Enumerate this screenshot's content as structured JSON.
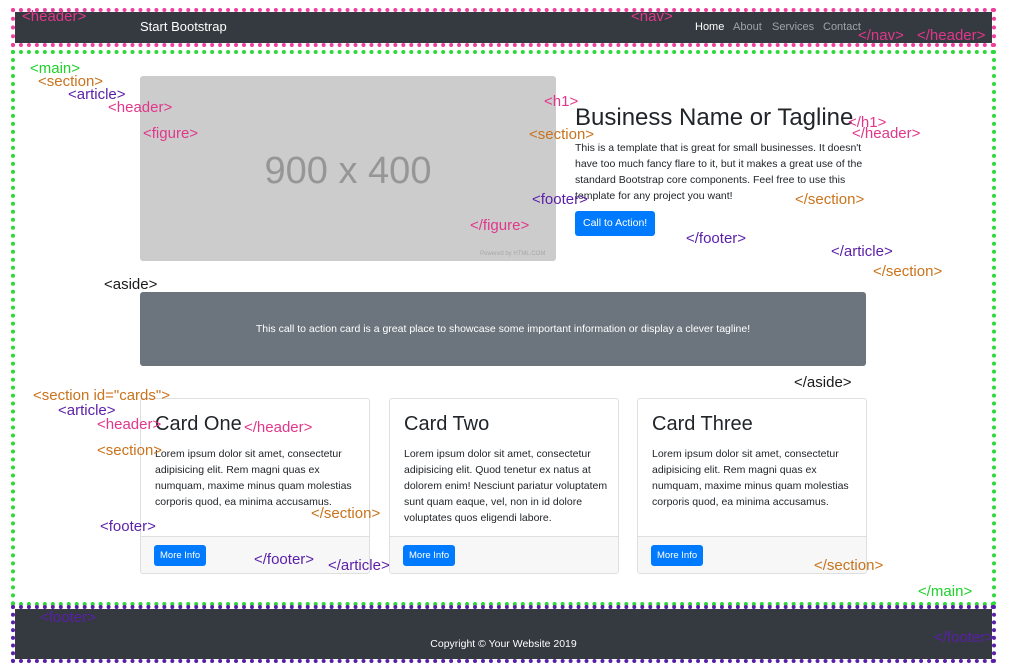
{
  "navbar": {
    "brand": "Start Bootstrap",
    "links": [
      "Home",
      "About",
      "Services",
      "Contact"
    ]
  },
  "hero": {
    "placeholder": "900 x 400",
    "powered": "Powered by HTML.COM",
    "title": "Business Name or Tagline",
    "text": "This is a template that is great for small businesses. It doesn't have too much fancy flare to it, but it makes a great use of the standard Bootstrap core components. Feel free to use this template for any project you want!",
    "button": "Call to Action!"
  },
  "cta": {
    "text": "This call to action card is a great place to showcase some important information or display a clever tagline!"
  },
  "cards": [
    {
      "title": "Card One",
      "text": "Lorem ipsum dolor sit amet, consectetur adipisicing elit. Rem magni quas ex numquam, maxime minus quam molestias corporis quod, ea minima accusamus.",
      "button": "More Info"
    },
    {
      "title": "Card Two",
      "text": "Lorem ipsum dolor sit amet, consectetur adipisicing elit. Quod tenetur ex natus at dolorem enim! Nesciunt pariatur voluptatem sunt quam eaque, vel, non in id dolore voluptates quos eligendi labore.",
      "button": "More Info"
    },
    {
      "title": "Card Three",
      "text": "Lorem ipsum dolor sit amet, consectetur adipisicing elit. Rem magni quas ex numquam, maxime minus quam molestias corporis quod, ea minima accusamus.",
      "button": "More Info"
    }
  ],
  "footer": {
    "copyright": "Copyright © Your Website 2019"
  },
  "tags": {
    "header_open": "<header>",
    "nav_open": "<nav>",
    "nav_close": "</nav>",
    "header_close": "</header>",
    "main_open": "<main>",
    "section_open": "<section>",
    "article_open": "<article>",
    "header_open_2": "<header>",
    "figure_open": "<figure>",
    "h1_open": "<h1>",
    "h1_close": "</h1>",
    "header_close_2": "</header>",
    "section_open_2": "<section>",
    "section_close": "</section>",
    "footer_open": "<footer>",
    "figure_close": "</figure>",
    "footer_close": "</footer>",
    "article_close": "</article>",
    "section_close_2": "</section>",
    "aside_open": "<aside>",
    "aside_close": "</aside>",
    "section_cards_open": "<section id=\"cards\">",
    "article_open_2": "<article>",
    "header_open_3": "<header>",
    "header_close_3": "</header>",
    "section_open_3": "<section>",
    "section_close_3": "</section>",
    "footer_open_2": "<footer>",
    "footer_close_2": "</footer>",
    "article_close_2": "</article>",
    "section_close_4": "</section>",
    "main_close": "</main>",
    "footer_open_3": "<footer>",
    "footer_close_3": "</footer>"
  },
  "colors": {
    "header_outline": "#ef3f9c",
    "main_outline": "#2ed83a",
    "footer_outline": "#5a1fa8",
    "navbar_bg": "#343a40",
    "primary": "#007bff",
    "cta_bg": "#6c757d"
  }
}
